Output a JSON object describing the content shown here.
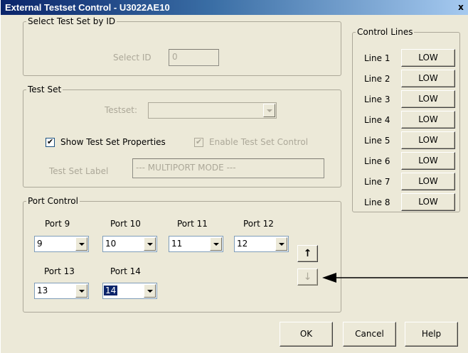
{
  "window": {
    "title": "External Testset Control - U3022AE10",
    "close_glyph": "x"
  },
  "select_by_id": {
    "group_label": "Select Test Set by ID",
    "select_id_label": "Select ID",
    "select_id_value": "0"
  },
  "test_set": {
    "group_label": "Test Set",
    "testset_label": "Testset:",
    "testset_value": "",
    "show_props_label": "Show Test Set Properties",
    "show_props_checked": true,
    "enable_control_label": "Enable Test Set Control",
    "enable_control_checked": true,
    "label_label": "Test Set Label",
    "label_value": "--- MULTIPORT MODE ---"
  },
  "control_lines": {
    "group_label": "Control Lines",
    "lines": [
      {
        "name": "Line 1",
        "state": "LOW"
      },
      {
        "name": "Line 2",
        "state": "LOW"
      },
      {
        "name": "Line 3",
        "state": "LOW"
      },
      {
        "name": "Line 4",
        "state": "LOW"
      },
      {
        "name": "Line 5",
        "state": "LOW"
      },
      {
        "name": "Line 6",
        "state": "LOW"
      },
      {
        "name": "Line 7",
        "state": "LOW"
      },
      {
        "name": "Line 8",
        "state": "LOW"
      }
    ]
  },
  "port_control": {
    "group_label": "Port Control",
    "ports": [
      {
        "label": "Port 9",
        "value": "9"
      },
      {
        "label": "Port 10",
        "value": "10"
      },
      {
        "label": "Port 11",
        "value": "11"
      },
      {
        "label": "Port 12",
        "value": "12"
      },
      {
        "label": "Port 13",
        "value": "13"
      },
      {
        "label": "Port 14",
        "value": "14"
      }
    ],
    "selected_port_value": "14",
    "up_arrow": "↑",
    "down_arrow": "↓"
  },
  "buttons": {
    "ok": "OK",
    "cancel": "Cancel",
    "help": "Help"
  },
  "colors": {
    "dialog_bg": "#ece9d8",
    "title_bar": "#0a246a",
    "disabled_text": "#aca899",
    "selection": "#0a246a"
  },
  "icons": {
    "close": "close-icon",
    "up": "arrow-up-icon",
    "down": "arrow-down-icon",
    "dropdown": "chevron-down-icon",
    "callout": "callout-arrow-icon"
  }
}
